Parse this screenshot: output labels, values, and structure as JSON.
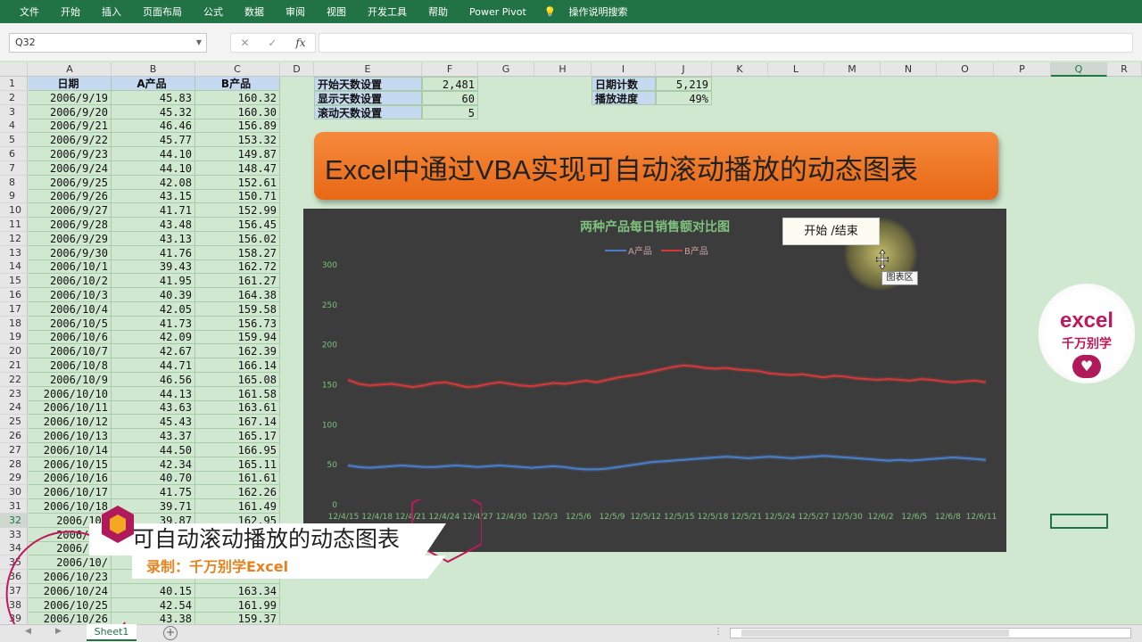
{
  "ribbon": {
    "tabs": [
      "文件",
      "开始",
      "插入",
      "页面布局",
      "公式",
      "数据",
      "审阅",
      "视图",
      "开发工具",
      "帮助",
      "Power Pivot",
      "操作说明搜索"
    ]
  },
  "formula_bar": {
    "name_box": "Q32",
    "fx": "fx"
  },
  "columns": [
    "A",
    "B",
    "C",
    "D",
    "E",
    "F",
    "G",
    "H",
    "I",
    "J",
    "K",
    "L",
    "M",
    "N",
    "O",
    "P",
    "Q",
    "R"
  ],
  "selected_column": "Q",
  "selected_row": 32,
  "table": {
    "headers": [
      "日期",
      "A产品",
      "B产品"
    ],
    "rows": [
      [
        "2006/9/19",
        "45.83",
        "160.32"
      ],
      [
        "2006/9/20",
        "45.32",
        "160.30"
      ],
      [
        "2006/9/21",
        "46.46",
        "156.89"
      ],
      [
        "2006/9/22",
        "45.77",
        "153.32"
      ],
      [
        "2006/9/23",
        "44.10",
        "149.87"
      ],
      [
        "2006/9/24",
        "44.10",
        "148.47"
      ],
      [
        "2006/9/25",
        "42.08",
        "152.61"
      ],
      [
        "2006/9/26",
        "43.15",
        "150.71"
      ],
      [
        "2006/9/27",
        "41.71",
        "152.99"
      ],
      [
        "2006/9/28",
        "43.48",
        "156.45"
      ],
      [
        "2006/9/29",
        "43.13",
        "156.02"
      ],
      [
        "2006/9/30",
        "41.76",
        "158.27"
      ],
      [
        "2006/10/1",
        "39.43",
        "162.72"
      ],
      [
        "2006/10/2",
        "41.95",
        "161.27"
      ],
      [
        "2006/10/3",
        "40.39",
        "164.38"
      ],
      [
        "2006/10/4",
        "42.05",
        "159.58"
      ],
      [
        "2006/10/5",
        "41.73",
        "156.73"
      ],
      [
        "2006/10/6",
        "42.09",
        "159.94"
      ],
      [
        "2006/10/7",
        "42.67",
        "162.39"
      ],
      [
        "2006/10/8",
        "44.71",
        "166.14"
      ],
      [
        "2006/10/9",
        "46.56",
        "165.08"
      ],
      [
        "2006/10/10",
        "44.13",
        "161.58"
      ],
      [
        "2006/10/11",
        "43.63",
        "163.61"
      ],
      [
        "2006/10/12",
        "45.43",
        "167.14"
      ],
      [
        "2006/10/13",
        "43.37",
        "165.17"
      ],
      [
        "2006/10/14",
        "44.50",
        "166.95"
      ],
      [
        "2006/10/15",
        "42.34",
        "165.11"
      ],
      [
        "2006/10/16",
        "40.70",
        "161.61"
      ],
      [
        "2006/10/17",
        "41.75",
        "162.26"
      ],
      [
        "2006/10/18",
        "39.71",
        "161.49"
      ],
      [
        "2006/10/",
        "39.87",
        "162.95"
      ],
      [
        "2006/10/",
        "",
        ""
      ],
      [
        "2006/10/",
        "",
        ""
      ],
      [
        "2006/10/",
        "",
        ""
      ],
      [
        "2006/10/23",
        "",
        ""
      ],
      [
        "2006/10/24",
        "40.15",
        "163.34"
      ],
      [
        "2006/10/25",
        "42.54",
        "161.99"
      ],
      [
        "2006/10/26",
        "43.38",
        "159.37"
      ]
    ]
  },
  "settings": {
    "start_label": "开始天数设置",
    "start_value": "2,481",
    "show_label": "显示天数设置",
    "show_value": "60",
    "scroll_label": "滚动天数设置",
    "scroll_value": "5",
    "count_label": "日期计数",
    "count_value": "5,219",
    "progress_label": "播放进度",
    "progress_value": "49%"
  },
  "banner": {
    "title": "Excel中通过VBA实现可自动滚动播放的动态图表"
  },
  "buttons": {
    "start_stop": "开始 /结束"
  },
  "tooltip": "图表区",
  "logo": {
    "line1": "excel",
    "line2": "千万别学"
  },
  "caption": {
    "line1": "可自动滚动播放的动态图表",
    "line2": "录制：千万别学Excel"
  },
  "sheet": {
    "tab": "Sheet1"
  },
  "colors": {
    "ribbon": "#217346",
    "grid_bg": "#cfe8cf",
    "header_fill": "#c5daf1",
    "chart_bg": "#3c3c3c",
    "series_a": "#4a7ec8",
    "series_b": "#d23a3a",
    "banner": "#f07a2a"
  },
  "chart_data": {
    "type": "line",
    "title": "两种产品每日销售额对比图",
    "ylim": [
      0,
      300
    ],
    "yticks": [
      "0",
      "50",
      "100",
      "150",
      "200",
      "250",
      "300"
    ],
    "xticklabels": [
      "12/4/15",
      "12/4/18",
      "12/4/21",
      "12/4/24",
      "12/4/27",
      "12/4/30",
      "12/5/3",
      "12/5/6",
      "12/5/9",
      "12/5/12",
      "12/5/15",
      "12/5/18",
      "12/5/21",
      "12/5/24",
      "12/5/27",
      "12/5/30",
      "12/6/2",
      "12/6/5",
      "12/6/8",
      "12/6/11"
    ],
    "legend": "top",
    "series": [
      {
        "name": "A产品",
        "color": "#4a7ec8",
        "values": [
          48,
          46,
          45,
          46,
          47,
          48,
          47,
          46,
          46,
          47,
          48,
          47,
          46,
          47,
          48,
          47,
          46,
          45,
          46,
          47,
          46,
          44,
          43,
          43,
          44,
          46,
          48,
          50,
          52,
          53,
          54,
          55,
          56,
          57,
          58,
          59,
          58,
          57,
          58,
          59,
          58,
          57,
          58,
          59,
          60,
          59,
          58,
          57,
          56,
          55,
          54,
          55,
          54,
          55,
          56,
          57,
          58,
          57,
          56,
          55
        ]
      },
      {
        "name": "B产品",
        "color": "#d23a3a",
        "values": [
          155,
          150,
          148,
          149,
          150,
          148,
          146,
          148,
          151,
          152,
          149,
          146,
          147,
          150,
          152,
          150,
          148,
          147,
          149,
          151,
          150,
          152,
          154,
          152,
          155,
          158,
          160,
          162,
          165,
          168,
          171,
          173,
          172,
          170,
          169,
          170,
          168,
          167,
          166,
          163,
          162,
          161,
          162,
          160,
          158,
          160,
          159,
          157,
          156,
          155,
          156,
          155,
          154,
          156,
          155,
          153,
          152,
          153,
          154,
          152
        ]
      }
    ]
  }
}
